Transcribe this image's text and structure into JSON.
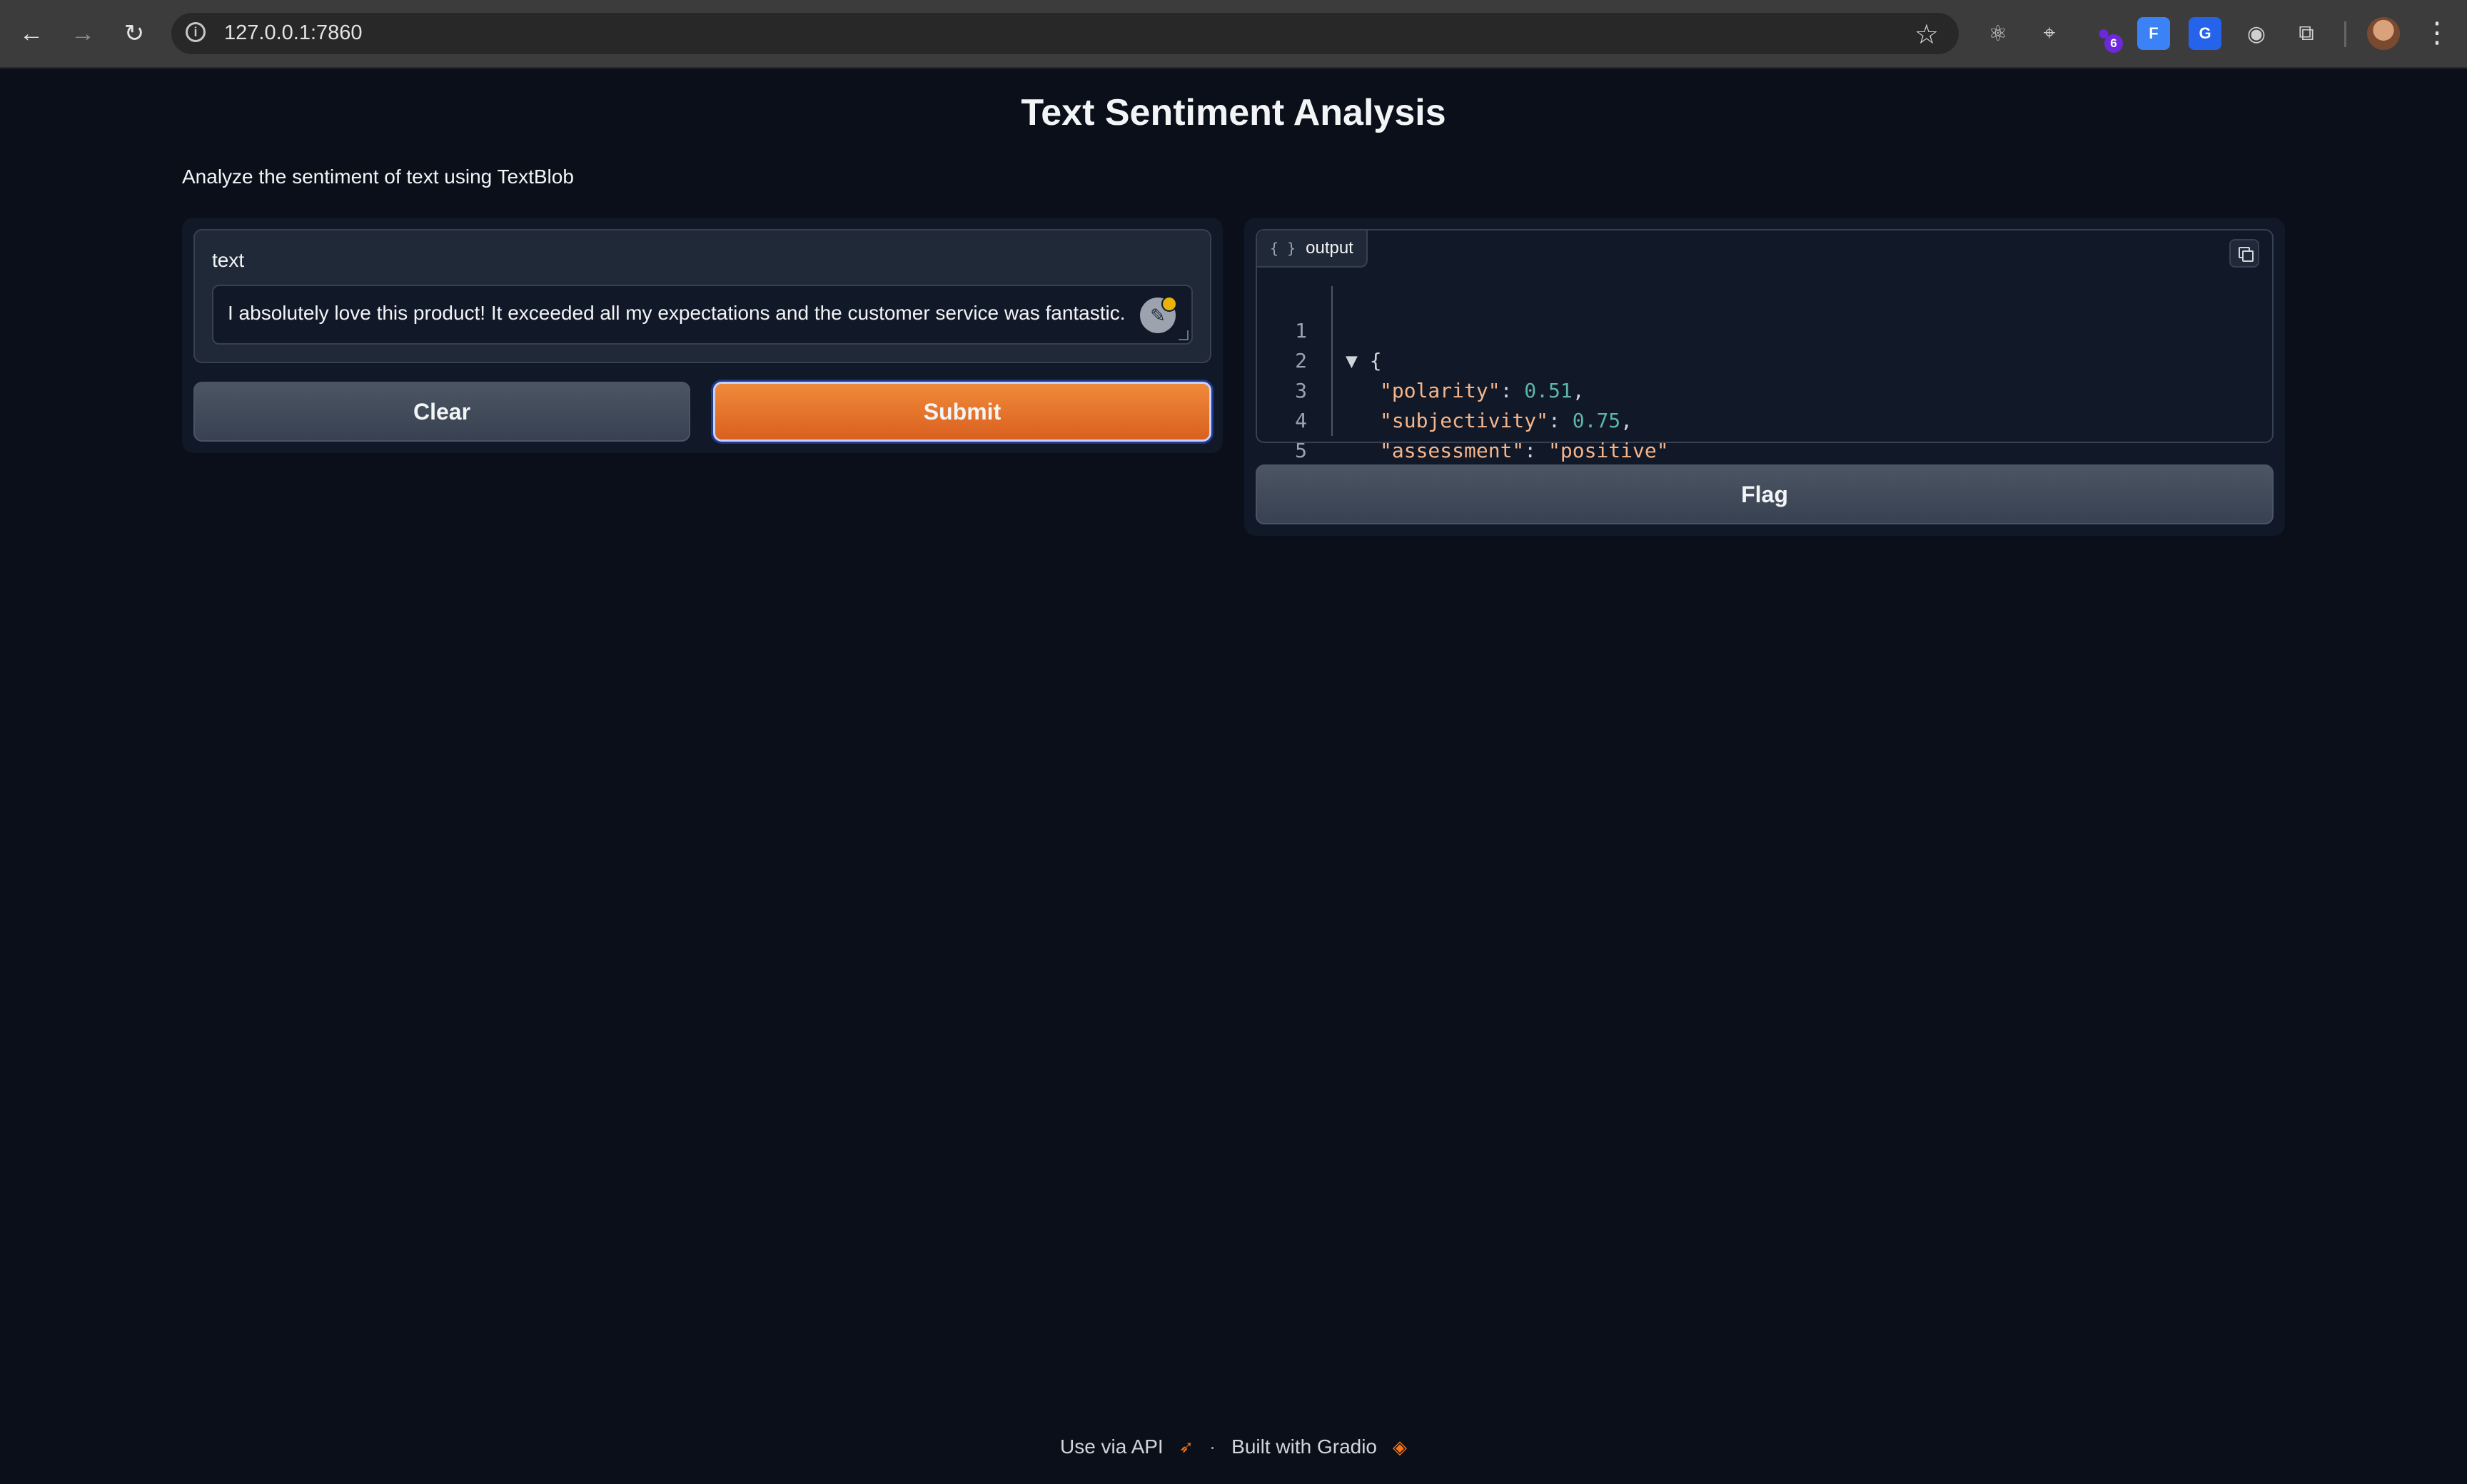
{
  "browser": {
    "url": "127.0.0.1:7860",
    "extension_badge_count": "6"
  },
  "app": {
    "title": "Text Sentiment Analysis",
    "description": "Analyze the sentiment of text using TextBlob"
  },
  "input": {
    "label": "text",
    "value": "I absolutely love this product! It exceeded all my expectations and the customer service was fantastic."
  },
  "buttons": {
    "clear": "Clear",
    "submit": "Submit",
    "flag": "Flag"
  },
  "output": {
    "label": "output",
    "json": {
      "polarity": 0.51,
      "subjectivity": 0.75,
      "assessment": "positive"
    },
    "lines": [
      {
        "num": "1",
        "open": "▼ {"
      },
      {
        "num": "2",
        "key": "\"polarity\"",
        "value": "0.51",
        "value_type": "number",
        "trail": ","
      },
      {
        "num": "3",
        "key": "\"subjectivity\"",
        "value": "0.75",
        "value_type": "number",
        "trail": ","
      },
      {
        "num": "4",
        "key": "\"assessment\"",
        "value": "\"positive\"",
        "value_type": "string",
        "trail": ""
      },
      {
        "num": "5",
        "close": "}"
      }
    ]
  },
  "footer": {
    "api_link": "Use via API",
    "separator": "·",
    "built_with": "Built with Gradio"
  },
  "colors": {
    "background": "#0b0f19",
    "panel": "#111827",
    "accent": "#e8712a",
    "secondary_button": "#4b5563"
  }
}
